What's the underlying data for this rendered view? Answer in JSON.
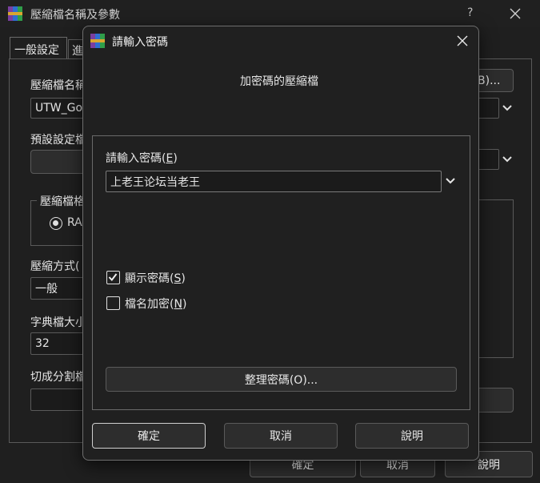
{
  "bg_window": {
    "title": "壓縮檔名稱及參數",
    "help_label": "?",
    "tabs": [
      "一般設定",
      "進"
    ],
    "archive_name_label": "壓縮檔名稱",
    "archive_name_value": "UTW_Go",
    "browse_label": "B)...",
    "profile_label": "預設設定檔",
    "format_group_label": "壓縮檔格",
    "format_radio_label": "RA",
    "method_label": "壓縮方式(",
    "method_value": "一般",
    "dict_label": "字典檔大小",
    "dict_value": "32",
    "split_label": "切成分割檔",
    "ok_label": "確定",
    "cancel_label": "取消",
    "help_button_label": "說明"
  },
  "dialog": {
    "title": "請輸入密碼",
    "heading": "加密碼的壓縮檔",
    "password_label": "請輸入密碼(E)",
    "password_value": "上老王论坛当老王",
    "show_password_label": "顯示密碼(S)",
    "show_password_checked": true,
    "encrypt_names_label": "檔名加密(N)",
    "encrypt_names_checked": false,
    "organize_label": "整理密碼(O)...",
    "ok_label": "確定",
    "cancel_label": "取消",
    "help_label": "說明"
  },
  "colors": {
    "window_bg": "#1f1f1f",
    "dialog_bg": "#202020",
    "accent_text": "#e6e6e6",
    "border": "#5a5a5a"
  }
}
